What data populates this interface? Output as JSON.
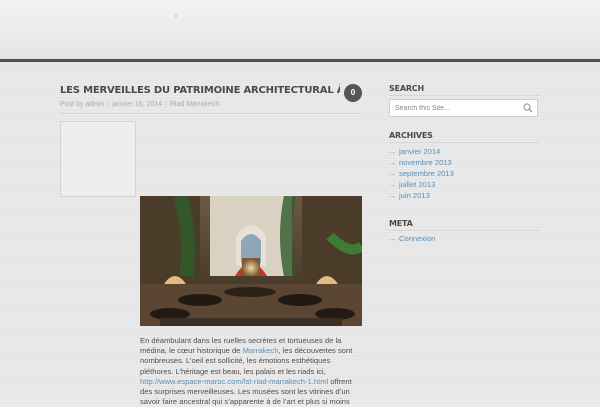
{
  "post": {
    "title": "Les merveilles du patrimoine architectural à Marrakech",
    "comment_count": "0",
    "meta": {
      "by_prefix": "Post by",
      "author": "admin",
      "date": "janvier 16, 2014",
      "category": "Riad Marrakech"
    },
    "body": {
      "text_1": "En déambulant dans les ruelles secrètes et tortueuses de la médina, le cœur historique de ",
      "link_1": "Marrakech",
      "text_2": ", les découvertes sont nombreuses. L’oeil est sollicité, les émotions esthétiques pléthores. L’héritage est beau, les palais et les riads ici, ",
      "link_2": "http://www.espace-maroc.com/lst-riad-marrakech-1.html",
      "text_3": " offrent des surprises merveilleuses. Les musées sont les vitrines d’un savoir faire ancestral qui s’apparente à de l’art et plus si moins"
    }
  },
  "sidebar": {
    "search": {
      "title": "Search",
      "placeholder": "Search this Site..."
    },
    "archives": {
      "title": "Archives",
      "items": [
        "janvier 2014",
        "novembre 2013",
        "septembre 2013",
        "juillet 2013",
        "juin 2013"
      ]
    },
    "meta": {
      "title": "Meta",
      "items": [
        "Connexion"
      ]
    }
  },
  "colors": {
    "link": "#5a8fb8",
    "header_rule": "#525252",
    "badge": "#555555"
  }
}
